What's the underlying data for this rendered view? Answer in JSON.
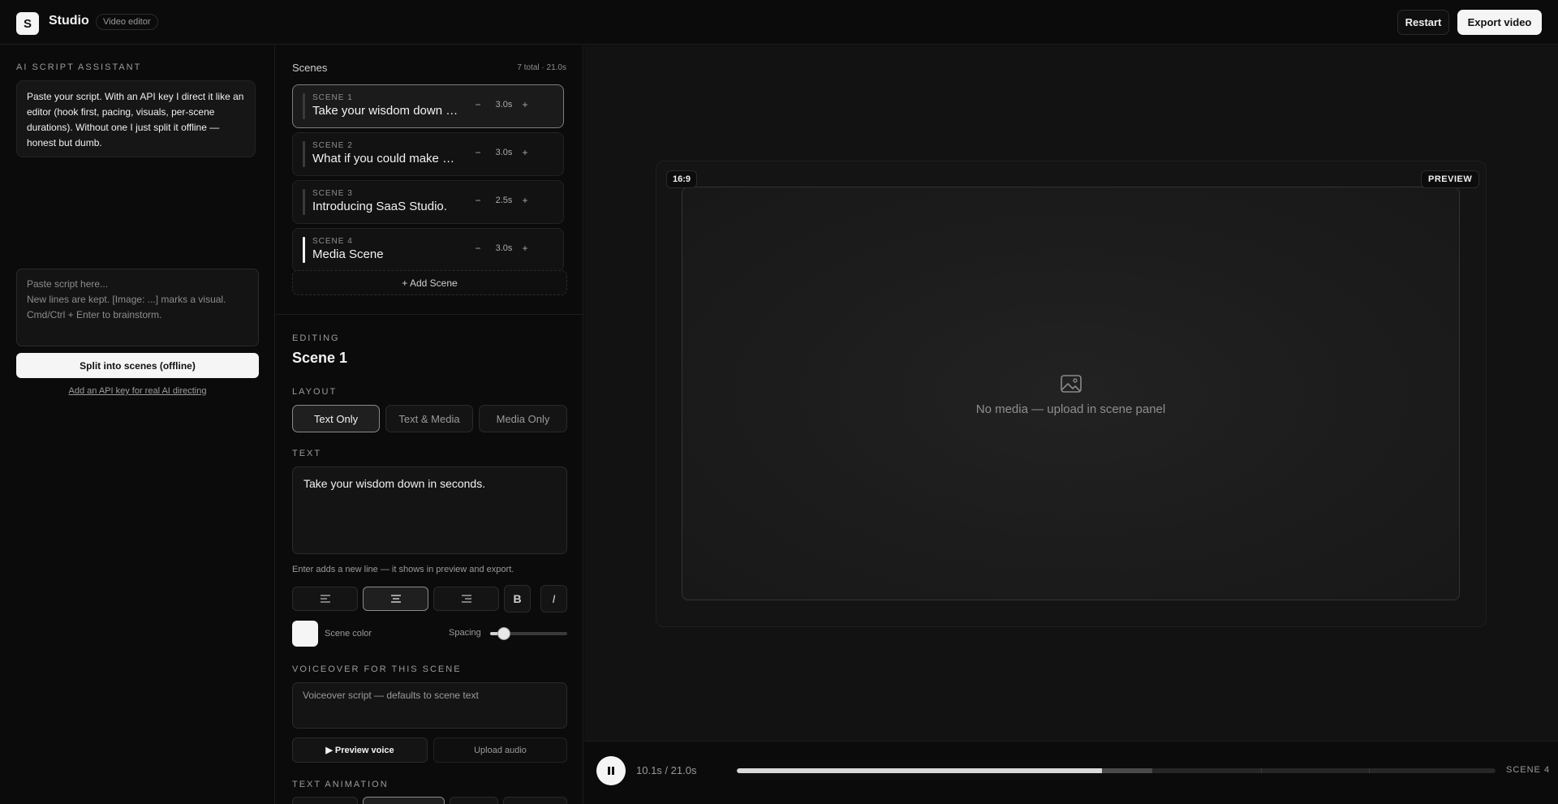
{
  "header": {
    "logo_letter": "S",
    "title": "Studio",
    "badge": "Video editor",
    "restart_label": "Restart",
    "export_label": "Export video"
  },
  "assistant": {
    "section_label": "AI SCRIPT ASSISTANT",
    "message": "Paste your script. With an API key I direct it like an editor (hook first, pacing, visuals, per-scene durations). Without one I just split it offline — honest but dumb.",
    "input_placeholder": "Paste script here...\nNew lines are kept. [Image: ...] marks a visual.\nCmd/Ctrl + Enter to brainstorm.",
    "input_value": "",
    "split_label": "Split into scenes (offline)",
    "api_link": "Add an API key for real AI directing"
  },
  "scenes": {
    "title": "Scenes",
    "count": "7 total · 21.0s",
    "add_label": "+ Add Scene",
    "items": [
      {
        "num": "SCENE 1",
        "text": "Take your wisdom down in seconds.",
        "duration": "3.0s",
        "minus": "−",
        "plus": "+"
      },
      {
        "num": "SCENE 2",
        "text": "What if you could make one video in minutes?",
        "duration": "3.0s",
        "minus": "−",
        "plus": "+"
      },
      {
        "num": "SCENE 3",
        "text": "Introducing SaaS Studio.",
        "duration": "2.5s",
        "minus": "−",
        "plus": "+"
      },
      {
        "num": "SCENE 4",
        "text": "Media Scene",
        "duration": "3.0s",
        "minus": "−",
        "plus": "+"
      }
    ],
    "active_index": 0,
    "current_index": 3
  },
  "editor": {
    "editing_label": "EDITING",
    "title": "Scene 1",
    "layout_label": "LAYOUT",
    "layouts": [
      "Text Only",
      "Text & Media",
      "Media Only"
    ],
    "layout_selected": "Text Only",
    "text_label": "TEXT",
    "text_value": "Take your wisdom down in seconds.",
    "hint": "Enter adds a new line — it shows in preview and export.",
    "align_selected": "center",
    "bold_label": "B",
    "italic_label": "I",
    "color_label": "Scene color",
    "scene_color": "#f5f5f5",
    "spacing_label": "Spacing",
    "spacing_fraction": 0.18,
    "voiceover_label": "VOICEOVER FOR THIS SCENE",
    "voiceover_placeholder": "Voiceover script — defaults to scene text",
    "preview_voice_label": "▶ Preview voice",
    "upload_audio_label": "Upload audio",
    "animation_label": "TEXT ANIMATION"
  },
  "preview": {
    "ratio": "16:9",
    "badge": "PREVIEW",
    "empty_message": "No media — upload in scene panel",
    "icon": "image-icon"
  },
  "transport": {
    "state": "playing",
    "time": "10.1s / 21.0s",
    "current_seconds": 10.1,
    "total_seconds": 21.0,
    "scene_boundaries": [
      3.0,
      6.0,
      8.5,
      11.5,
      14.5,
      17.5,
      21.0
    ],
    "scene_label": "SCENE 4"
  },
  "colors": {
    "background": "#0b0b0b",
    "accent": "#f5f5f5",
    "panel": "#141414"
  }
}
